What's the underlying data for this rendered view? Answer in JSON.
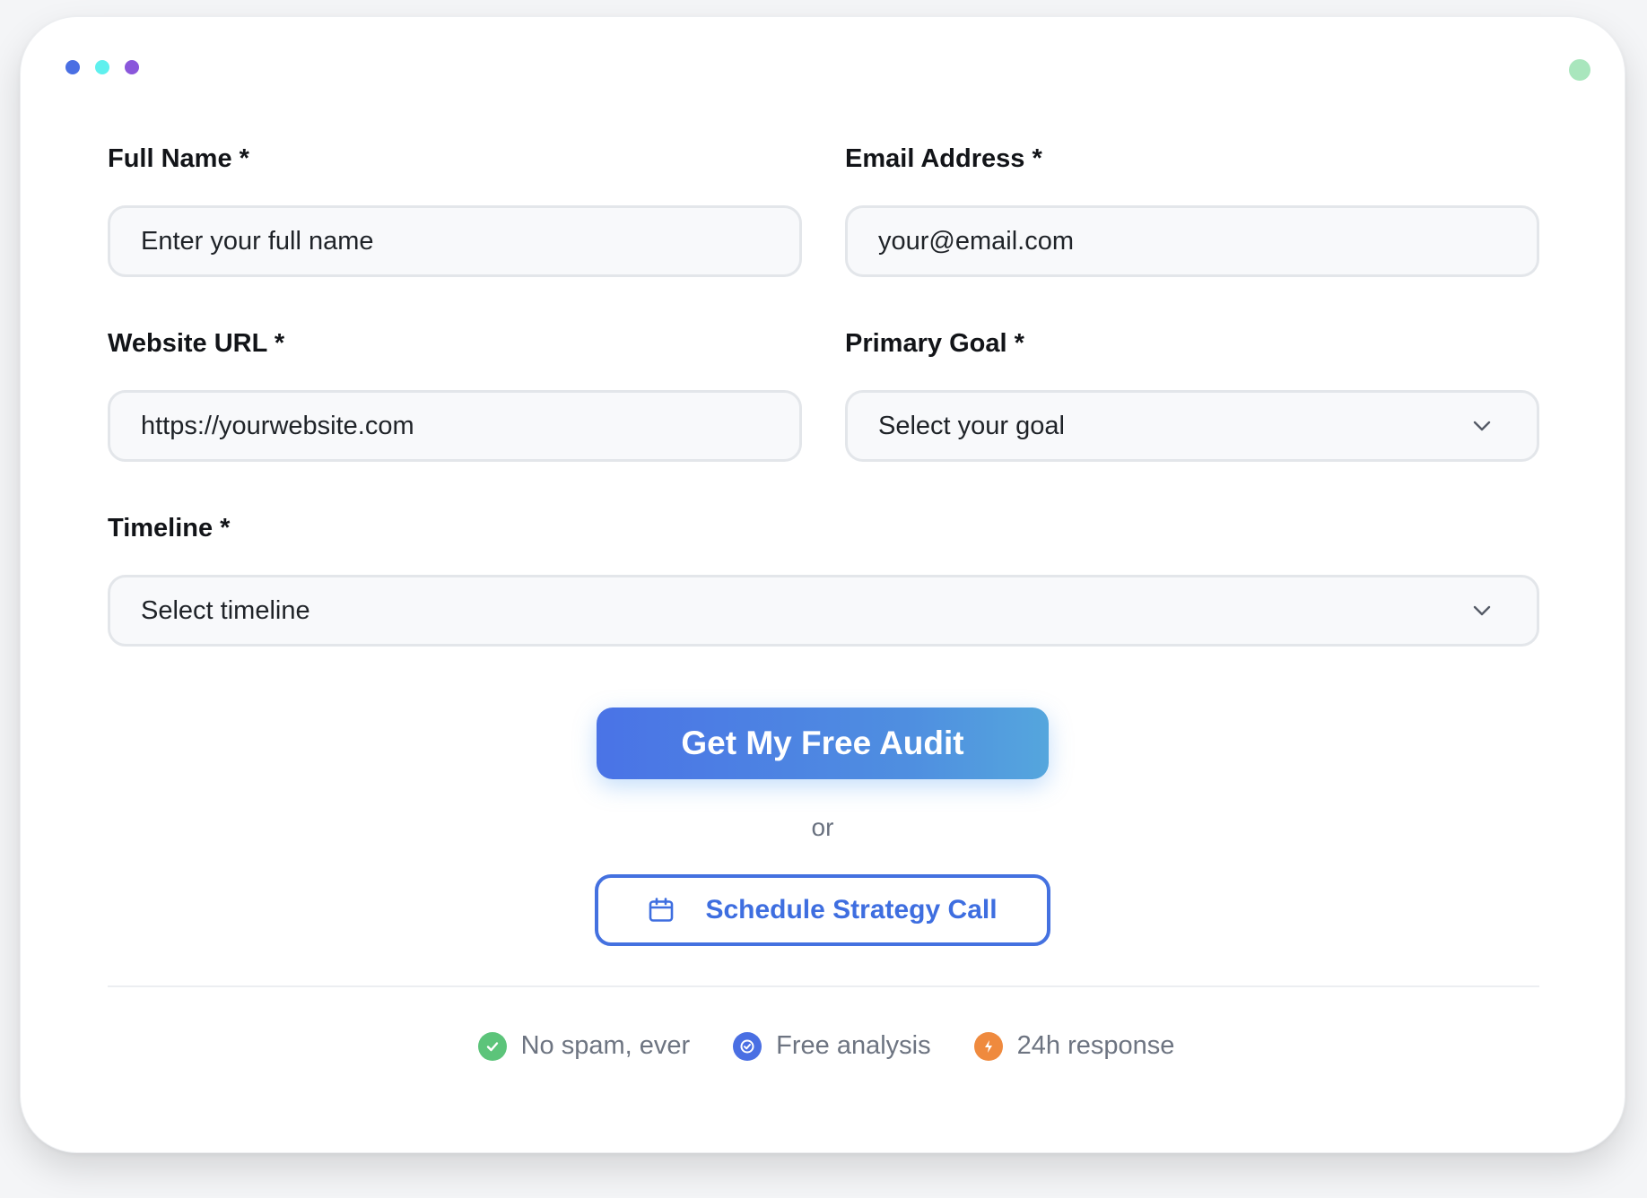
{
  "window": {
    "dots": [
      "#4a6fe3",
      "#5ff0ee",
      "#8a57db"
    ],
    "status_color": "#a9e6bd"
  },
  "form": {
    "full_name": {
      "label": "Full Name *",
      "placeholder": "Enter your full name"
    },
    "email": {
      "label": "Email Address *",
      "placeholder": "your@email.com"
    },
    "website": {
      "label": "Website URL *",
      "placeholder": "https://yourwebsite.com"
    },
    "goal": {
      "label": "Primary Goal *",
      "selected": "Select your goal"
    },
    "timeline": {
      "label": "Timeline *",
      "selected": "Select timeline"
    }
  },
  "actions": {
    "primary_label": "Get My Free Audit",
    "or_text": "or",
    "secondary_label": "Schedule Strategy Call",
    "secondary_icon": "calendar-icon",
    "primary_gradient": [
      "#4a73e6",
      "#55a6dd"
    ],
    "accent": "#4471e0"
  },
  "badges": [
    {
      "icon": "check-icon",
      "label": "No spam, ever",
      "color": "#5cc47a"
    },
    {
      "icon": "check-circle-icon",
      "label": "Free analysis",
      "color": "#4a6fe3"
    },
    {
      "icon": "lightning-icon",
      "label": "24h response",
      "color": "#ef8a3e"
    }
  ]
}
